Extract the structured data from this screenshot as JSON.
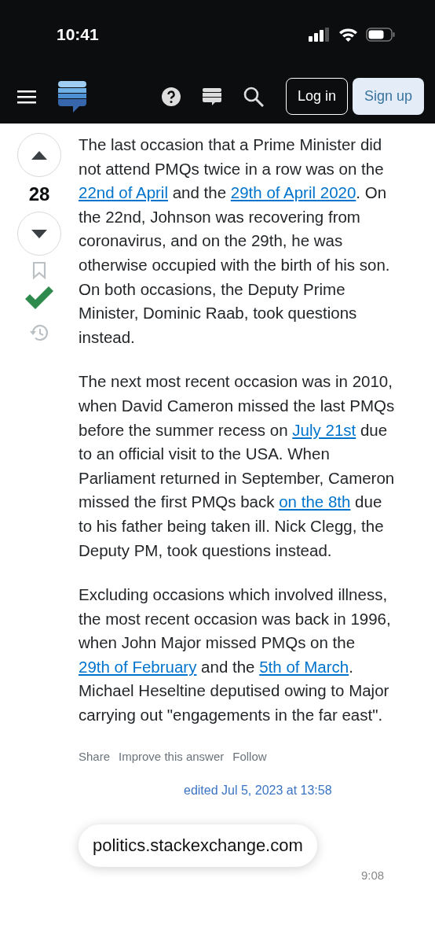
{
  "status_bar": {
    "time": "10:41"
  },
  "nav": {
    "login": "Log in",
    "signup": "Sign up"
  },
  "votes": {
    "score": "28",
    "accepted": true
  },
  "paragraphs": [
    [
      {
        "text": "The last occasion that a Prime Minister did not attend PMQs twice in a row was on the "
      },
      {
        "link": "22nd of April"
      },
      {
        "text": " and the "
      },
      {
        "link": "29th of April 2020"
      },
      {
        "text": ". On the 22nd, Johnson was recovering from coronavirus, and on the 29th, he was otherwise occupied with the birth of his son. On both occasions, the Deputy Prime Minister, Dominic Raab, took questions instead."
      }
    ],
    [
      {
        "text": "The next most recent occasion was in 2010, when David Cameron missed the last PMQs before the summer recess on "
      },
      {
        "link": "July 21st"
      },
      {
        "text": " due to an official visit to the USA. When Parliament returned in September, Cameron missed the first PMQs back "
      },
      {
        "link": "on the 8th"
      },
      {
        "text": " due to his father being taken ill. Nick Clegg, the Deputy PM, took questions instead."
      }
    ],
    [
      {
        "text": "Excluding occasions which involved illness, the most recent occasion was back in 1996, when John Major missed PMQs on the "
      },
      {
        "link": "29th of February"
      },
      {
        "text": " and the "
      },
      {
        "link": "5th of March"
      },
      {
        "text": ". Michael Heseltine deputised owing to Major carrying out \"engagements in the far east\"."
      }
    ]
  ],
  "post_menu": [
    "Share",
    "Improve this answer",
    "Follow"
  ],
  "edited": "edited Jul 5, 2023 at 13:58",
  "url_bar": "politics.stackexchange.com",
  "answered_fragment": "9:08"
}
